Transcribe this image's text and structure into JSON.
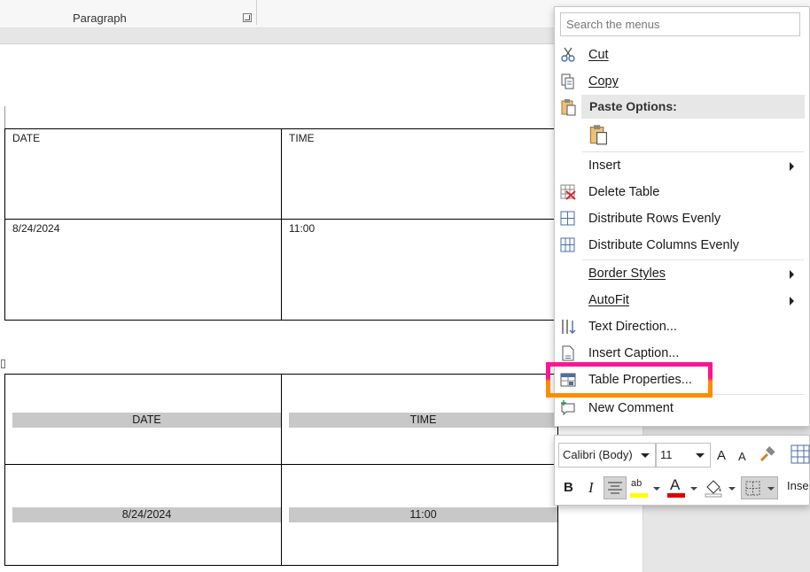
{
  "ribbon": {
    "group_label": "Paragraph"
  },
  "table1": {
    "rows": [
      [
        "DATE",
        "TIME"
      ],
      [
        "8/24/2024",
        "11:00"
      ]
    ]
  },
  "table2": {
    "rows": [
      [
        "DATE",
        "TIME"
      ],
      [
        "8/24/2024",
        "11:00"
      ]
    ]
  },
  "context_menu": {
    "search_placeholder": "Search the menus",
    "items": {
      "cut": "Cut",
      "copy": "Copy",
      "paste_options": "Paste Options:",
      "insert": "Insert",
      "delete_table": "Delete Table",
      "distribute_rows": "Distribute Rows Evenly",
      "distribute_columns": "Distribute Columns Evenly",
      "border_styles": "Border Styles",
      "autofit": "AutoFit",
      "text_direction": "Text Direction...",
      "insert_caption": "Insert Caption...",
      "table_properties": "Table Properties...",
      "new_comment": "New Comment"
    },
    "highlight_colors": [
      "#ff1493",
      "#ff8c00"
    ]
  },
  "mini_toolbar": {
    "font": "Calibri (Body)",
    "size": "11",
    "bold": "B",
    "italic": "I",
    "grow_font": "A",
    "shrink_font": "A",
    "insert_partial": "Inse",
    "highlight_color": "#ffff00",
    "font_color": "#e00000"
  }
}
